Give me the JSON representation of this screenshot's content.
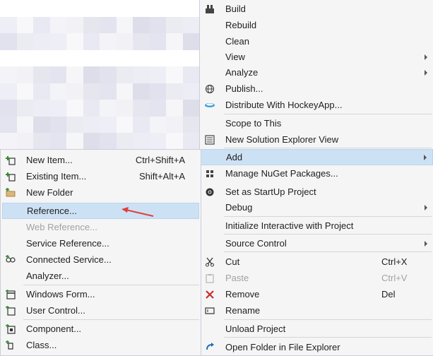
{
  "colors": {
    "menu_bg": "#f5f5f5",
    "highlight": "#cde1f5",
    "arrow": "#e0403a",
    "disabled": "#a2a2a2"
  },
  "context_menu": {
    "build": "Build",
    "rebuild": "Rebuild",
    "clean": "Clean",
    "view": "View",
    "analyze": "Analyze",
    "publish": "Publish...",
    "distribute": "Distribute With HockeyApp...",
    "scope": "Scope to This",
    "new_view": "New Solution Explorer View",
    "add": "Add",
    "nuget": "Manage NuGet Packages...",
    "startup": "Set as StartUp Project",
    "debug": "Debug",
    "interactive": "Initialize Interactive with Project",
    "source_control": "Source Control",
    "cut": "Cut",
    "cut_shortcut": "Ctrl+X",
    "paste": "Paste",
    "paste_shortcut": "Ctrl+V",
    "remove": "Remove",
    "remove_shortcut": "Del",
    "rename": "Rename",
    "unload": "Unload Project",
    "open_folder": "Open Folder in File Explorer"
  },
  "add_submenu": {
    "new_item": "New Item...",
    "new_item_shortcut": "Ctrl+Shift+A",
    "existing_item": "Existing Item...",
    "existing_item_shortcut": "Shift+Alt+A",
    "new_folder": "New Folder",
    "reference": "Reference...",
    "web_reference": "Web Reference...",
    "service_reference": "Service Reference...",
    "connected_service": "Connected Service...",
    "analyzer": "Analyzer...",
    "windows_form": "Windows Form...",
    "user_control": "User Control...",
    "component": "Component...",
    "class": "Class..."
  }
}
